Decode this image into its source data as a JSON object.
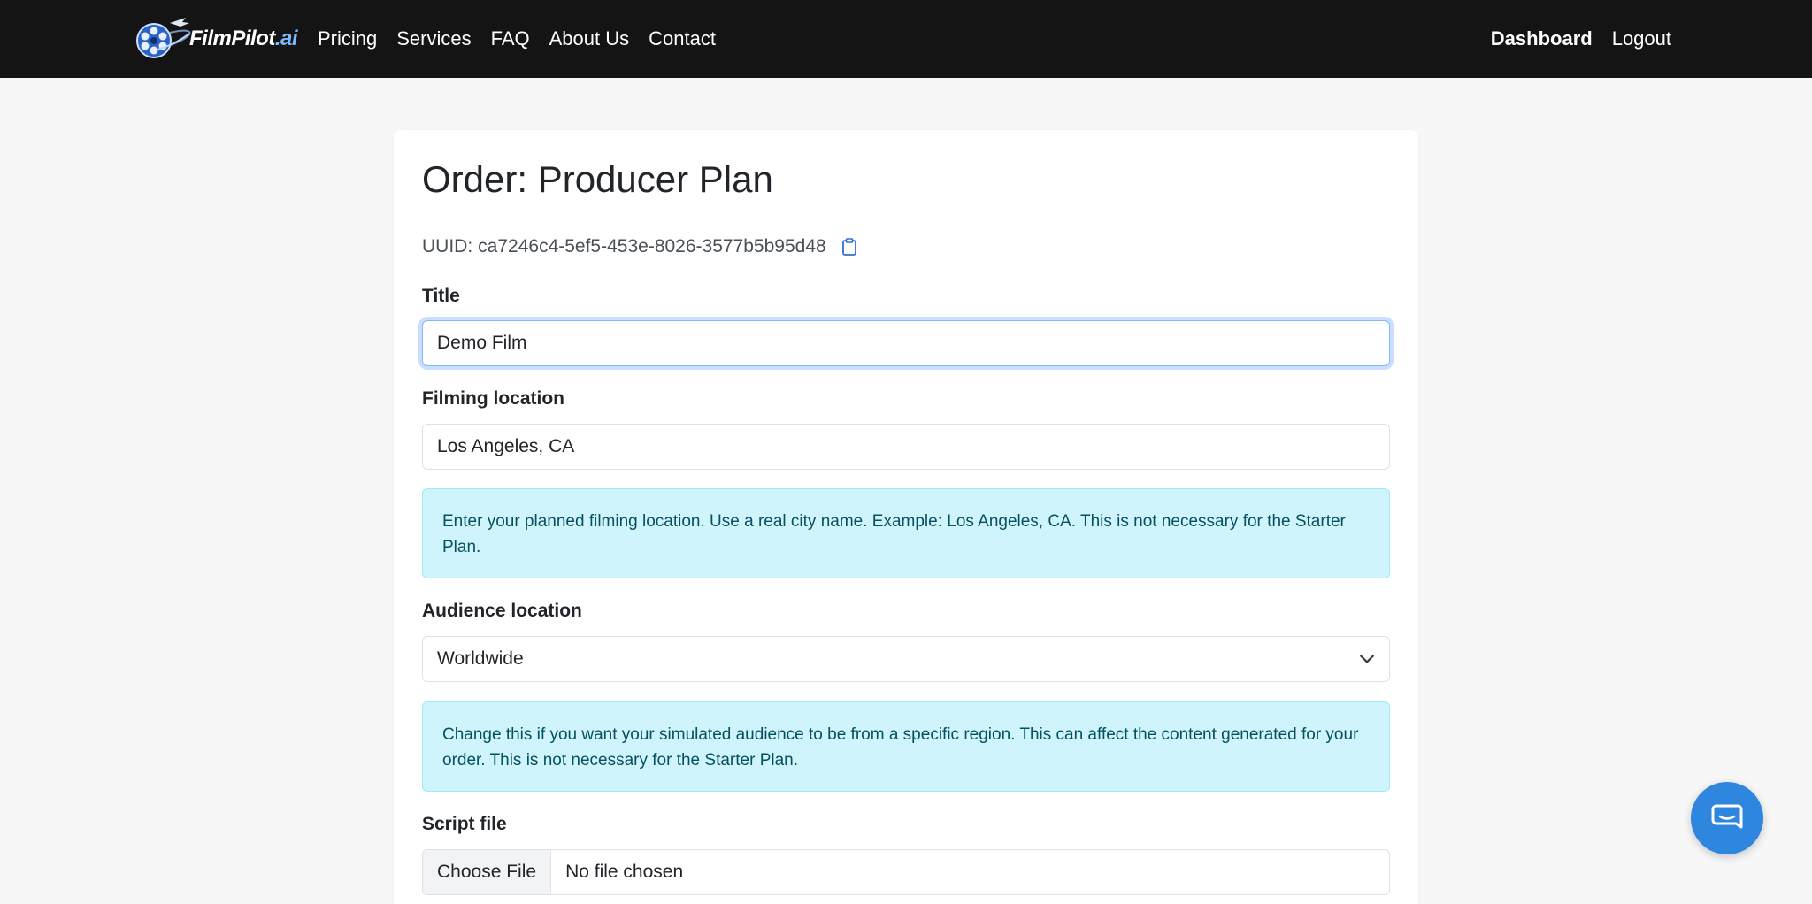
{
  "nav": {
    "brand_main": "FilmPilot",
    "brand_ai": ".ai",
    "links": [
      "Pricing",
      "Services",
      "FAQ",
      "About Us",
      "Contact"
    ],
    "dashboard": "Dashboard",
    "logout": "Logout"
  },
  "order": {
    "title": "Order: Producer Plan",
    "uuid_label": "UUID:",
    "uuid_value": "ca7246c4-5ef5-453e-8026-3577b5b95d48"
  },
  "form": {
    "title_label": "Title",
    "title_value": "Demo Film",
    "location_label": "Filming location",
    "location_value": "Los Angeles, CA",
    "location_help": "Enter your planned filming location. Use a real city name. Example: Los Angeles, CA. This is not necessary for the Starter Plan.",
    "audience_label": "Audience location",
    "audience_value": "Worldwide",
    "audience_help": "Change this if you want your simulated audience to be from a specific region. This can affect the content generated for your order. This is not necessary for the Starter Plan.",
    "script_label": "Script file",
    "file_button": "Choose File",
    "file_status": "No file chosen"
  },
  "colors": {
    "navbar": "#141414",
    "info_bg": "#cff4fc",
    "info_text": "#055160",
    "help_bubble": "#2e86de"
  },
  "icons": [
    "film-reel-logo-icon",
    "clipboard-icon",
    "chevron-down-icon",
    "chat-bubble-icon"
  ]
}
